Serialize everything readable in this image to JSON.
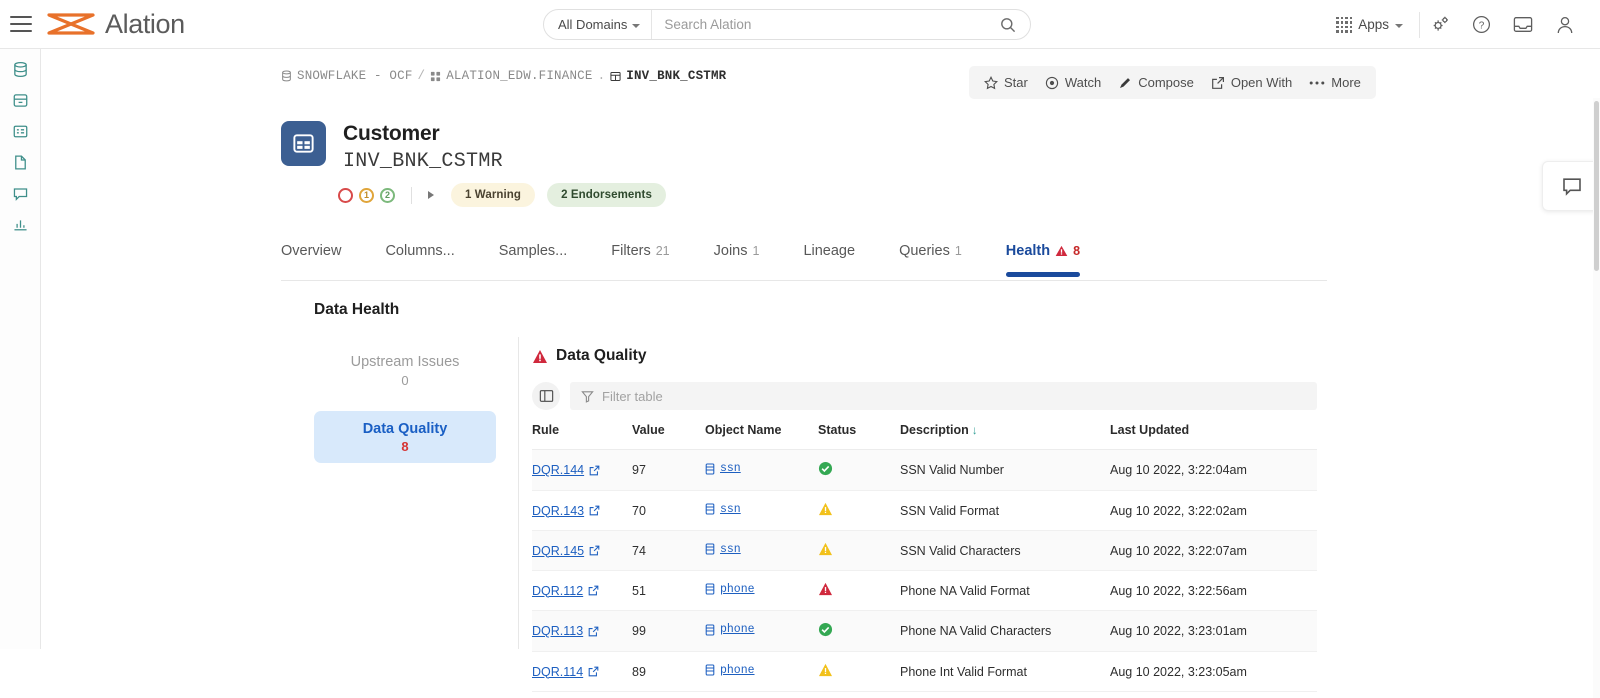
{
  "topbar": {
    "menu_label": "main-menu",
    "brand": "Alation",
    "domain_selector": "All Domains",
    "search_placeholder": "Search Alation",
    "search_value": "",
    "apps_label": "Apps",
    "icons": [
      "settings-icon",
      "help-icon",
      "inbox-icon",
      "user-icon"
    ]
  },
  "rail": {
    "items": [
      {
        "name": "database-icon"
      },
      {
        "name": "archive-icon"
      },
      {
        "name": "table-icon"
      },
      {
        "name": "document-icon"
      },
      {
        "name": "conversation-icon"
      },
      {
        "name": "chart-icon"
      }
    ]
  },
  "breadcrumb": {
    "source": "SNOWFLAKE - OCF",
    "separator1": "/",
    "schema": "ALATION_EDW.FINANCE",
    "separator2": ".",
    "table": "INV_BNK_CSTMR"
  },
  "actionbar": {
    "items": [
      {
        "label": "Star",
        "icon": "star-icon"
      },
      {
        "label": "Watch",
        "icon": "eye-icon"
      },
      {
        "label": "Compose",
        "icon": "pen-icon"
      },
      {
        "label": "Open With",
        "icon": "external-link-icon"
      },
      {
        "label": "More",
        "icon": "ellipsis-icon"
      }
    ]
  },
  "header": {
    "icon": "table-object-icon",
    "title": "Customer",
    "subtitle": "INV_BNK_CSTMR",
    "rings": [
      {
        "name": "health-ring-red",
        "value": "",
        "color": "#d84a4a"
      },
      {
        "name": "health-ring-amber",
        "value": "1",
        "color": "#e0a53a"
      },
      {
        "name": "health-ring-green",
        "value": "2",
        "color": "#7cb97c"
      }
    ],
    "pills": [
      {
        "label": "1 Warning",
        "kind": "warn"
      },
      {
        "label": "2 Endorsements",
        "kind": "endorse"
      }
    ]
  },
  "tabs": [
    {
      "label": "Overview",
      "count": "",
      "active": false
    },
    {
      "label": "Columns...",
      "count": "",
      "active": false
    },
    {
      "label": "Samples...",
      "count": "",
      "active": false
    },
    {
      "label": "Filters",
      "count": "21",
      "active": false
    },
    {
      "label": "Joins",
      "count": "1",
      "active": false
    },
    {
      "label": "Lineage",
      "count": "",
      "active": false
    },
    {
      "label": "Queries",
      "count": "1",
      "active": false
    },
    {
      "label": "Health",
      "count": "8",
      "active": true
    }
  ],
  "data_health": {
    "section_title": "Data Health",
    "options": [
      {
        "label": "Upstream Issues",
        "value": "0",
        "selected": false
      },
      {
        "label": "Data Quality",
        "value": "8",
        "selected": true
      }
    ]
  },
  "data_quality": {
    "panel_title": "Data Quality",
    "panel_icon": "warning-triangle-icon",
    "columns_button": "columns-toggle-icon",
    "filter_icon": "filter-icon",
    "filter_placeholder": "Filter table",
    "filter_value": "",
    "headers": [
      "Rule",
      "Value",
      "Object Name",
      "Status",
      "Description",
      "Last Updated"
    ],
    "sorted_column": "Description",
    "sort_direction": "↓",
    "rows": [
      {
        "rule": "DQR.144",
        "value": "97",
        "object": "ssn",
        "status": "good",
        "description": "SSN Valid Number",
        "updated": "Aug 10 2022, 3:22:04am"
      },
      {
        "rule": "DQR.143",
        "value": "70",
        "object": "ssn",
        "status": "warning",
        "description": "SSN Valid Format",
        "updated": "Aug 10 2022, 3:22:02am"
      },
      {
        "rule": "DQR.145",
        "value": "74",
        "object": "ssn",
        "status": "warning",
        "description": "SSN Valid Characters",
        "updated": "Aug 10 2022, 3:22:07am"
      },
      {
        "rule": "DQR.112",
        "value": "51",
        "object": "phone",
        "status": "alert",
        "description": "Phone NA Valid Format",
        "updated": "Aug 10 2022, 3:22:56am"
      },
      {
        "rule": "DQR.113",
        "value": "99",
        "object": "phone",
        "status": "good",
        "description": "Phone NA Valid Characters",
        "updated": "Aug 10 2022, 3:23:01am"
      },
      {
        "rule": "DQR.114",
        "value": "89",
        "object": "phone",
        "status": "warning",
        "description": "Phone Int Valid Format",
        "updated": "Aug 10 2022, 3:23:05am"
      }
    ]
  },
  "chat_widget": {
    "icon": "chat-bubble-icon"
  },
  "colors": {
    "brand_orange": "#e8712a",
    "accent_blue": "#1a4a9c",
    "link_blue": "#1d5fc0",
    "status_good": "#34a853",
    "status_warning": "#f2c11b",
    "status_alert": "#d0293d",
    "rail_teal": "#3e8f8a"
  }
}
